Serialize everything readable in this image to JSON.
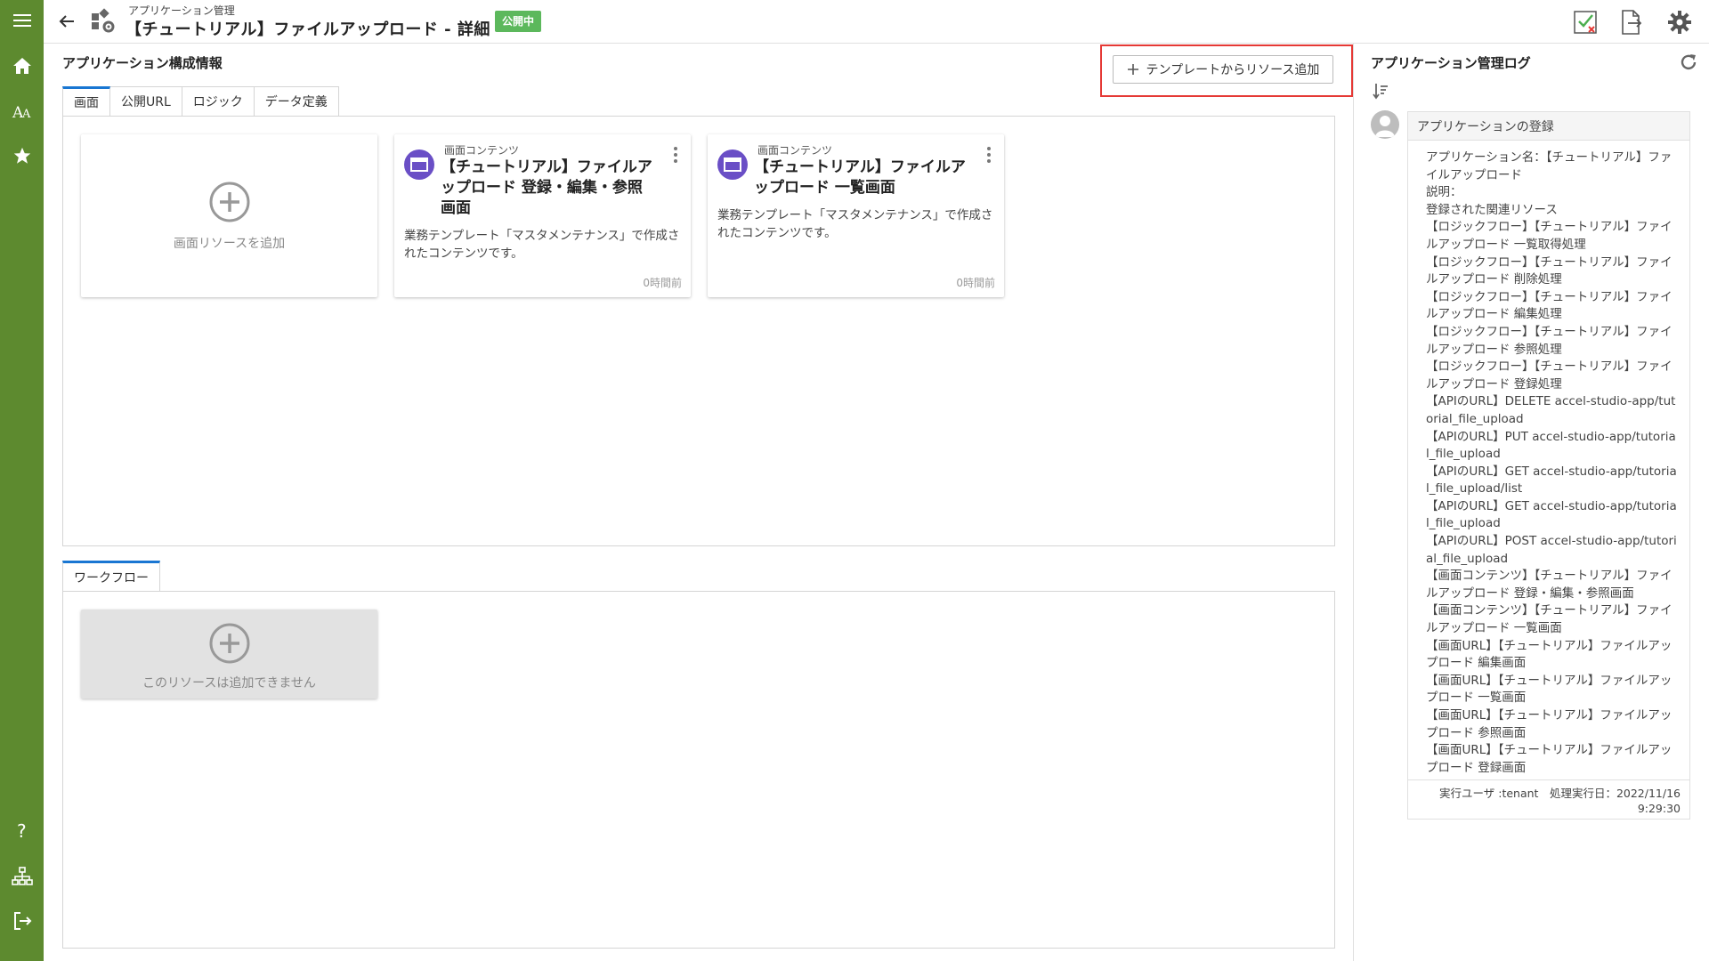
{
  "nav": {
    "items": [
      "menu-icon",
      "home-icon",
      "font-icon",
      "star-icon",
      "help-icon",
      "sitemap-icon",
      "logout-icon"
    ]
  },
  "header": {
    "breadcrumb": "アプリケーション管理",
    "title": "【チュートリアル】ファイルアップロード - 詳細",
    "status_badge": "公開中",
    "status_color": "#5cb85c"
  },
  "main": {
    "section_title": "アプリケーション構成情報",
    "add_template_button": "テンプレートからリソース追加",
    "tabs": [
      {
        "label": "画面",
        "active": true
      },
      {
        "label": "公開URL",
        "active": false
      },
      {
        "label": "ロジック",
        "active": false
      },
      {
        "label": "データ定義",
        "active": false
      }
    ],
    "add_screen_label": "画面リソースを追加",
    "cards": [
      {
        "type": "画面コンテンツ",
        "title": "【チュートリアル】ファイルアップロード 登録・編集・参照画面",
        "description": "業務テンプレート「マスタメンテナンス」で作成されたコンテンツです。",
        "time": "0時間前"
      },
      {
        "type": "画面コンテンツ",
        "title": "【チュートリアル】ファイルアップロード 一覧画面",
        "description": "業務テンプレート「マスタメンテナンス」で作成されたコンテンツです。",
        "time": "0時間前"
      }
    ],
    "workflow_tab": "ワークフロー",
    "workflow_disabled_label": "このリソースは追加できません"
  },
  "log": {
    "title": "アプリケーション管理ログ",
    "entry_title": "アプリケーションの登録",
    "lines": [
      "アプリケーション名：【チュートリアル】ファイルアップロード",
      "説明：",
      "登録された関連リソース",
      "【ロジックフロー】【チュートリアル】ファイルアップロード 一覧取得処理",
      "【ロジックフロー】【チュートリアル】ファイルアップロード 削除処理",
      "【ロジックフロー】【チュートリアル】ファイルアップロード 編集処理",
      "【ロジックフロー】【チュートリアル】ファイルアップロード 参照処理",
      "【ロジックフロー】【チュートリアル】ファイルアップロード 登録処理",
      "【APIのURL】DELETE accel-studio-app/tutorial_file_upload",
      "【APIのURL】PUT accel-studio-app/tutorial_file_upload",
      "【APIのURL】GET accel-studio-app/tutorial_file_upload/list",
      "【APIのURL】GET accel-studio-app/tutorial_file_upload",
      "【APIのURL】POST accel-studio-app/tutorial_file_upload",
      "【画面コンテンツ】【チュートリアル】ファイルアップロード 登録・編集・参照画面",
      "【画面コンテンツ】【チュートリアル】ファイルアップロード 一覧画面",
      "【画面URL】【チュートリアル】ファイルアップロード 編集画面",
      "【画面URL】【チュートリアル】ファイルアップロード 一覧画面",
      "【画面URL】【チュートリアル】ファイルアップロード 参照画面",
      "【画面URL】【チュートリアル】ファイルアップロード 登録画面"
    ],
    "footer_user": "実行ユーザ :tenant　処理実行日：2022/11/16",
    "footer_time": "9:29:30"
  }
}
